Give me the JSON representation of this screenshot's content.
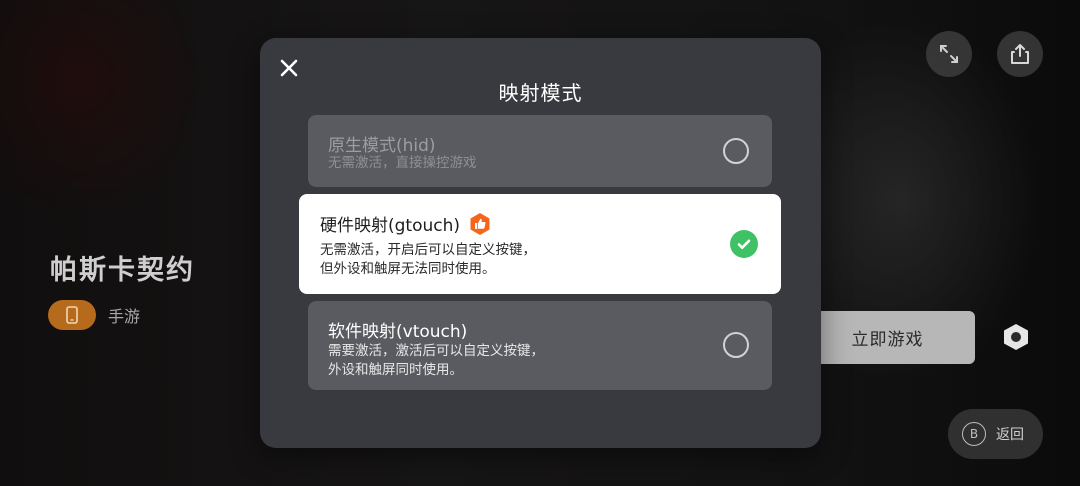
{
  "background": {
    "game_title": "帕斯卡契约",
    "tag_label": "手游",
    "play_button": "立即游戏",
    "back_key": "B",
    "back_label": "返回",
    "icons": [
      "phone-icon",
      "expand-icon",
      "share-icon",
      "settings-hex-icon"
    ]
  },
  "modal": {
    "title": "映射模式",
    "close_icon": "close-icon",
    "options": [
      {
        "title": "原生模式(hid)",
        "desc_lines": [
          "无需激活，直接操控游戏"
        ],
        "selected": false,
        "disabled": true
      },
      {
        "title": "硬件映射(gtouch)",
        "desc_lines": [
          "无需激活，开启后可以自定义按键，",
          "但外设和触屏无法同时使用。"
        ],
        "selected": true,
        "recommended": true,
        "badge_icon": "thumbs-up-icon"
      },
      {
        "title": "软件映射(vtouch)",
        "desc_lines": [
          "需要激活，激活后可以自定义按键，",
          "外设和触屏同时使用。"
        ],
        "selected": false,
        "disabled": false
      }
    ]
  },
  "colors": {
    "modal_bg": "#383a3f",
    "option_bg": "#595b61",
    "selected_bg": "#ffffff",
    "check_green": "#3fc166",
    "badge_orange": "#f4661c",
    "tag_orange": "#b66a1b"
  }
}
